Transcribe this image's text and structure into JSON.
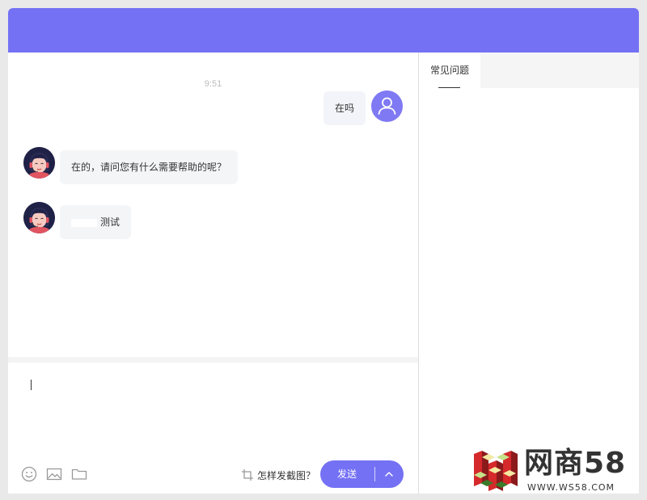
{
  "chat": {
    "timestamp": "9:51",
    "messages": [
      {
        "from": "user",
        "text": "在吗"
      },
      {
        "from": "agent",
        "text": "在的，请问您有什么需要帮助的呢？"
      },
      {
        "from": "agent",
        "text": "测试"
      }
    ]
  },
  "composer": {
    "value": "",
    "screenshot_help": "怎样发截图？",
    "send_label": "发送"
  },
  "sidebar": {
    "tabs": [
      {
        "label": "常见问题",
        "active": true
      }
    ]
  },
  "watermark": {
    "name": "网商58",
    "url": "WWW.WS58.COM"
  },
  "colors": {
    "brand": "#7471f4",
    "bubble": "#f4f5f7",
    "agent_avatar_bg": "#1f2146",
    "agent_accent": "#e15561"
  },
  "icons": {
    "user_avatar": "user-icon",
    "emoji": "emoji-icon",
    "image": "image-icon",
    "file": "folder-icon",
    "crop": "crop-icon",
    "expand": "chevron-up-icon"
  }
}
